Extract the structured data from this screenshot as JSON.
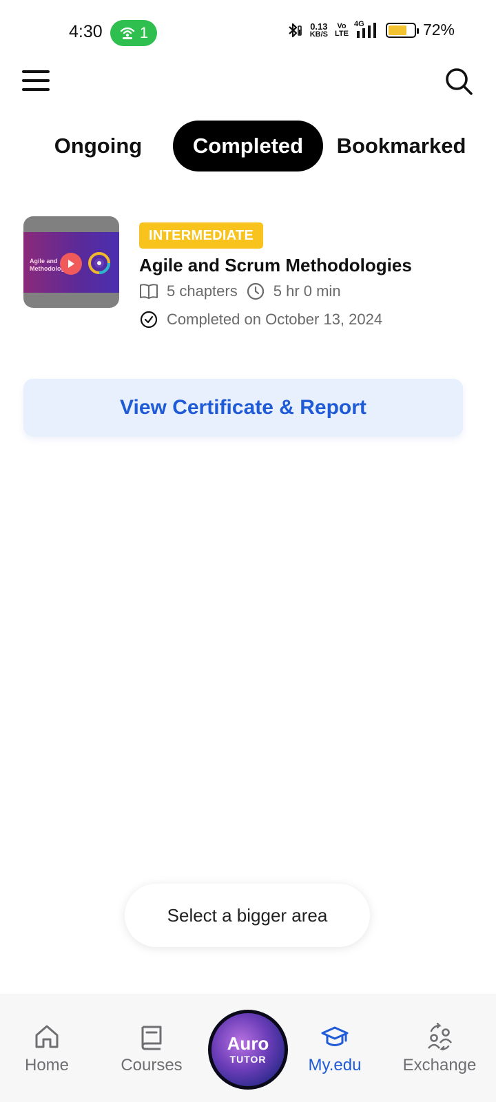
{
  "status_bar": {
    "time": "4:30",
    "hotspot_count": "1",
    "net_speed_value": "0.13",
    "net_speed_unit": "KB/S",
    "volte_top": "Vo",
    "volte_bottom": "LTE",
    "network": "4G",
    "battery_percent": "72%",
    "battery_level": 0.72,
    "hotspot_color": "#2ebf4f",
    "battery_color": "#f2c230"
  },
  "header": {
    "menu_icon": "hamburger-menu-icon",
    "search_icon": "search-icon"
  },
  "tabs": [
    {
      "label": "Ongoing",
      "active": false
    },
    {
      "label": "Completed",
      "active": true
    },
    {
      "label": "Bookmarked",
      "active": false
    }
  ],
  "course": {
    "level": "INTERMEDIATE",
    "title": "Agile and Scrum Methodologies",
    "chapters": "5 chapters",
    "duration": "5 hr 0 min",
    "completed_text": "Completed on October 13, 2024",
    "thumbnail_text_line1": "Agile and",
    "thumbnail_text_line2": "Methodolog",
    "level_color": "#f7c31c"
  },
  "cta": {
    "label": "View Certificate & Report",
    "color": "#1f5bd6"
  },
  "toast": {
    "text": "Select a bigger area"
  },
  "bottom_nav": {
    "items": [
      {
        "label": "Home",
        "icon": "home-icon",
        "active": false
      },
      {
        "label": "Courses",
        "icon": "book-icon",
        "active": false
      },
      {
        "label": "My.edu",
        "icon": "graduation-cap-icon",
        "active": true
      },
      {
        "label": "Exchange",
        "icon": "exchange-users-icon",
        "active": false
      }
    ],
    "center": {
      "title": "Auro",
      "subtitle": "TUTOR"
    },
    "active_color": "#1f5bd6"
  }
}
